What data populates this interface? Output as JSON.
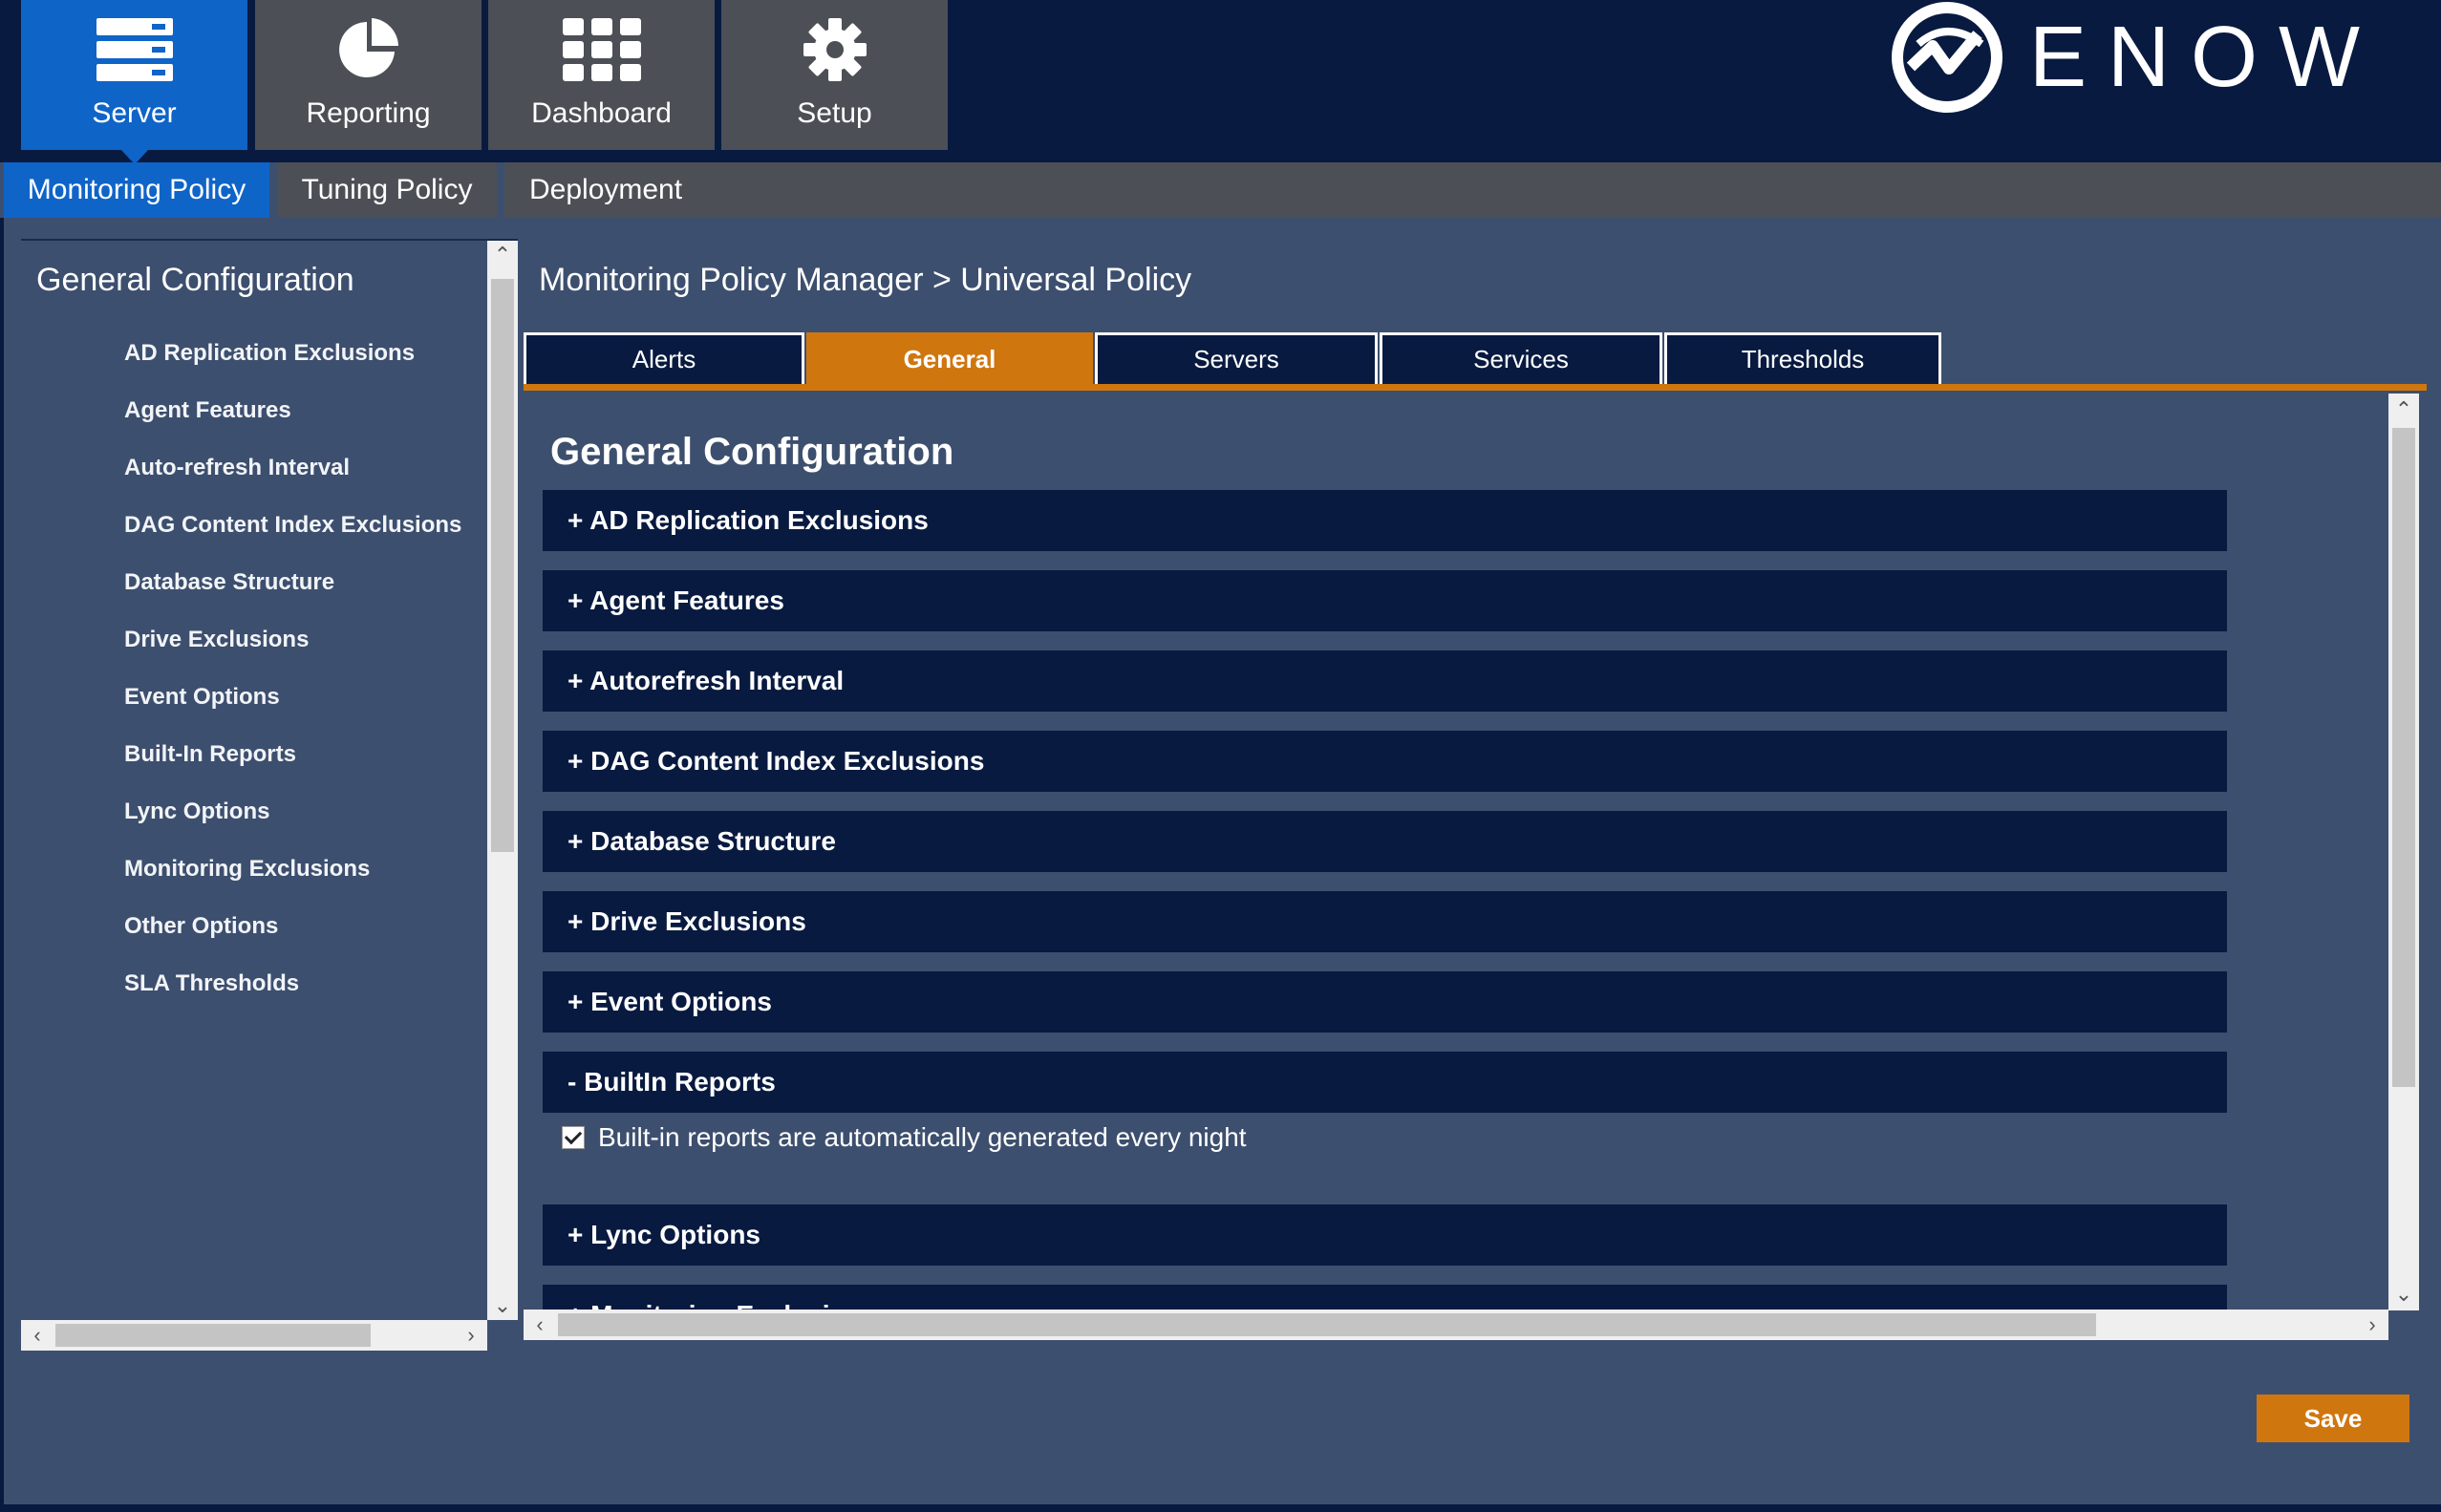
{
  "brand": {
    "logo_word": "ENOW"
  },
  "nav": {
    "tiles": [
      {
        "label": "Server",
        "icon": "server-icon",
        "active": true
      },
      {
        "label": "Reporting",
        "icon": "pie-chart-icon",
        "active": false
      },
      {
        "label": "Dashboard",
        "icon": "grid-icon",
        "active": false
      },
      {
        "label": "Setup",
        "icon": "gear-icon",
        "active": false
      }
    ]
  },
  "subtabs": [
    {
      "label": "Monitoring Policy",
      "active": true
    },
    {
      "label": "Tuning Policy",
      "active": false
    },
    {
      "label": "Deployment",
      "active": false
    }
  ],
  "sidebar": {
    "title": "General Configuration",
    "items": [
      "AD Replication Exclusions",
      "Agent Features",
      "Auto-refresh Interval",
      "DAG Content Index Exclusions",
      "Database Structure",
      "Drive Exclusions",
      "Event Options",
      "Built-In Reports",
      "Lync Options",
      "Monitoring Exclusions",
      "Other Options",
      "SLA Thresholds"
    ]
  },
  "main": {
    "breadcrumb": "Monitoring Policy Manager > Universal Policy",
    "tabs": [
      {
        "label": "Alerts",
        "active": false
      },
      {
        "label": "General",
        "active": true
      },
      {
        "label": "Servers",
        "active": false
      },
      {
        "label": "Services",
        "active": false
      },
      {
        "label": "Thresholds",
        "active": false
      }
    ],
    "heading": "General Configuration",
    "sections": [
      "+ AD Replication Exclusions",
      "+ Agent Features",
      "+ Autorefresh Interval",
      "+ DAG Content Index Exclusions",
      "+ Database Structure",
      "+ Drive Exclusions",
      "+ Event Options",
      "- BuiltIn Reports",
      "+ Lync Options",
      "+ Monitoring Exclusions"
    ],
    "builtin_checkbox": {
      "label": "Built-in reports are automatically generated every night",
      "checked": true
    }
  },
  "footer": {
    "save_label": "Save"
  },
  "colors": {
    "navy": "#081a40",
    "panel": "#3d4f6e",
    "active_blue": "#0f64c8",
    "accent_orange": "#d0760f",
    "tile_gray": "#4c4f55"
  }
}
